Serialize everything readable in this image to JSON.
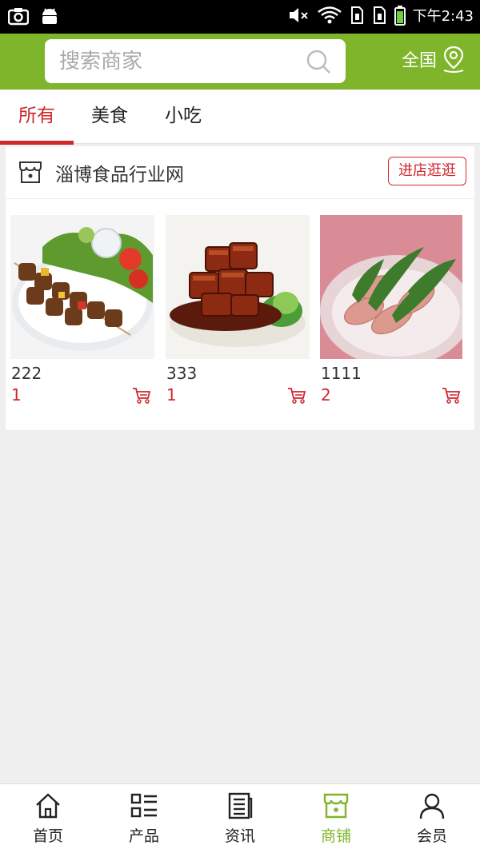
{
  "status_bar": {
    "time": "下午2:43"
  },
  "header": {
    "search_placeholder": "搜索商家",
    "region_label": "全国",
    "colors": {
      "brand_green": "#7fb52b"
    }
  },
  "tabs": [
    {
      "label": "所有",
      "active": true
    },
    {
      "label": "美食",
      "active": false
    },
    {
      "label": "小吃",
      "active": false
    }
  ],
  "shop": {
    "name": "淄博食品行业网",
    "visit_label": "进店逛逛",
    "products": [
      {
        "name": "222",
        "price": "1",
        "image": "kebab-skewers-photo"
      },
      {
        "name": "333",
        "price": "1",
        "image": "braised-pork-photo"
      },
      {
        "name": "1111",
        "price": "2",
        "image": "ham-rolls-photo"
      }
    ]
  },
  "bottom_nav": [
    {
      "label": "首页",
      "icon": "home-icon",
      "active": false
    },
    {
      "label": "产品",
      "icon": "list-icon",
      "active": false
    },
    {
      "label": "资讯",
      "icon": "news-icon",
      "active": false
    },
    {
      "label": "商铺",
      "icon": "store-icon",
      "active": true
    },
    {
      "label": "会员",
      "icon": "user-icon",
      "active": false
    }
  ],
  "colors": {
    "accent_red": "#d0262c",
    "active_green": "#7fb52b"
  }
}
